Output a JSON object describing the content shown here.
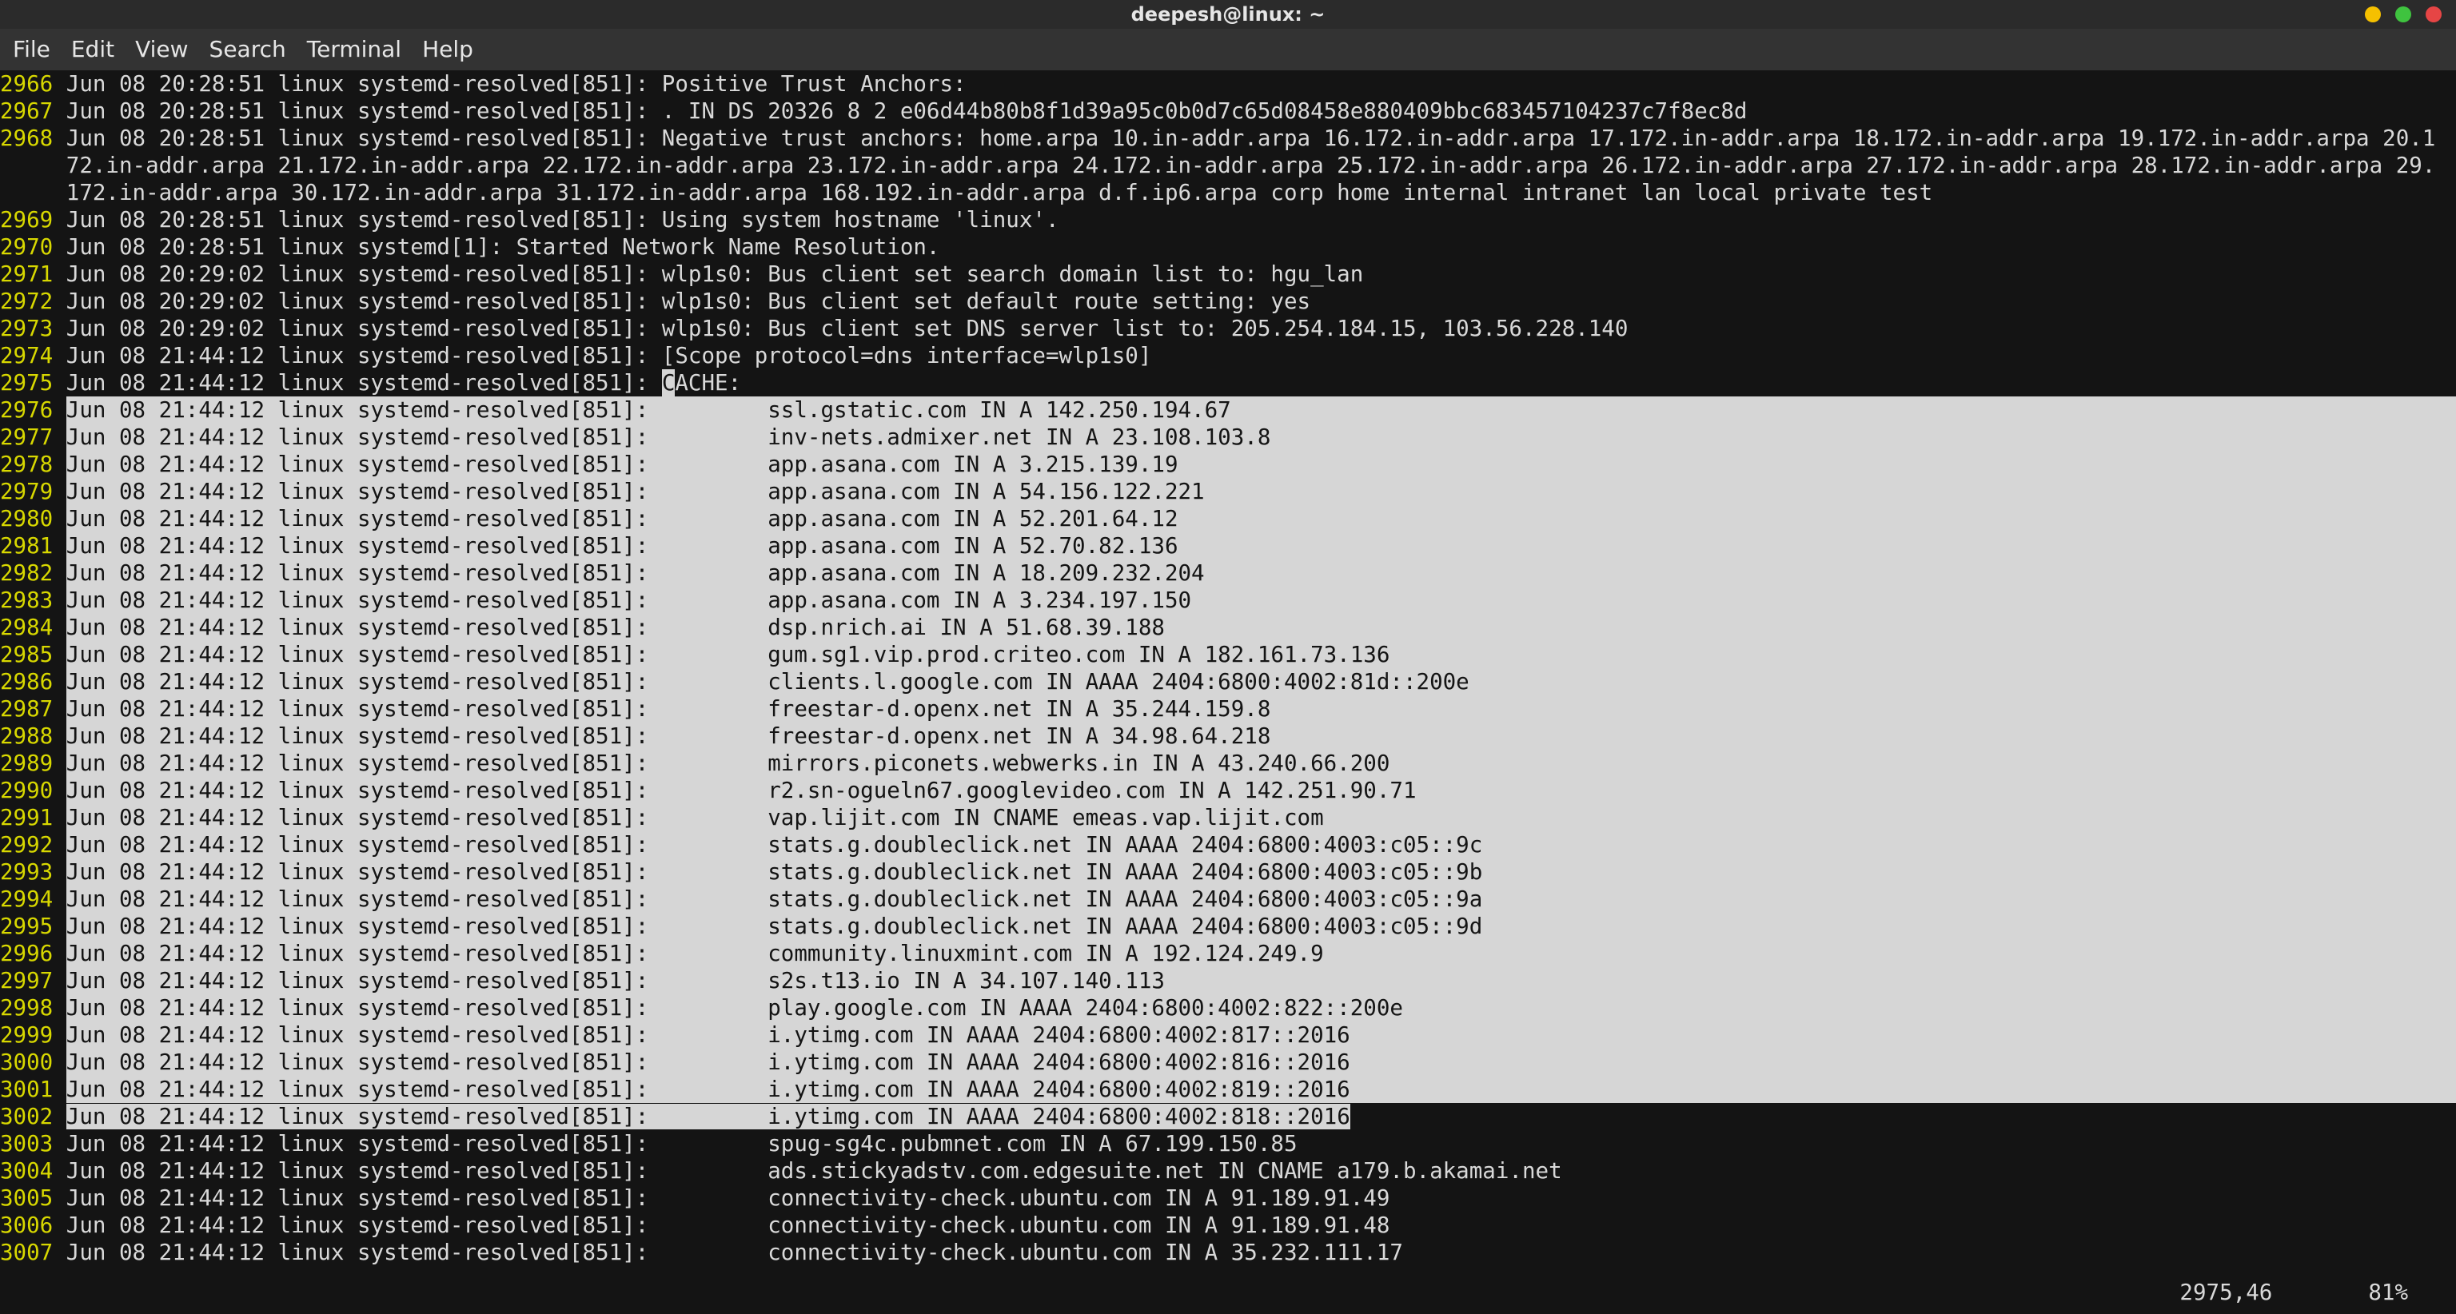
{
  "window": {
    "title": "deepesh@linux: ~"
  },
  "menubar": {
    "items": [
      "File",
      "Edit",
      "View",
      "Search",
      "Terminal",
      "Help"
    ]
  },
  "log_prefix_common": "Jun 08 21:44:12 linux systemd-resolved[851]:",
  "lines": [
    {
      "n": "2966",
      "text": "Jun 08 20:28:51 linux systemd-resolved[851]: Positive Trust Anchors:"
    },
    {
      "n": "2967",
      "text": "Jun 08 20:28:51 linux systemd-resolved[851]: . IN DS 20326 8 2 e06d44b80b8f1d39a95c0b0d7c65d08458e880409bbc683457104237c7f8ec8d"
    },
    {
      "n": "2968",
      "text": "Jun 08 20:28:51 linux systemd-resolved[851]: Negative trust anchors: home.arpa 10.in-addr.arpa 16.172.in-addr.arpa 17.172.in-addr.arpa 18.172.in-addr.arpa 19.172.in-addr.arpa 20.172.in-addr.arpa 21.172.in-addr.arpa 22.172.in-addr.arpa 23.172.in-addr.arpa 24.172.in-addr.arpa 25.172.in-addr.arpa 26.172.in-addr.arpa 27.172.in-addr.arpa 28.172.in-addr.arpa 29.172.in-addr.arpa 30.172.in-addr.arpa 31.172.in-addr.arpa 168.192.in-addr.arpa d.f.ip6.arpa corp home internal intranet lan local private test"
    },
    {
      "n": "2969",
      "text": "Jun 08 20:28:51 linux systemd-resolved[851]: Using system hostname 'linux'."
    },
    {
      "n": "2970",
      "text": "Jun 08 20:28:51 linux systemd[1]: Started Network Name Resolution."
    },
    {
      "n": "2971",
      "text": "Jun 08 20:29:02 linux systemd-resolved[851]: wlp1s0: Bus client set search domain list to: hgu_lan"
    },
    {
      "n": "2972",
      "text": "Jun 08 20:29:02 linux systemd-resolved[851]: wlp1s0: Bus client set default route setting: yes"
    },
    {
      "n": "2973",
      "text": "Jun 08 20:29:02 linux systemd-resolved[851]: wlp1s0: Bus client set DNS server list to: 205.254.184.15, 103.56.228.140"
    },
    {
      "n": "2974",
      "text": "Jun 08 21:44:12 linux systemd-resolved[851]: [Scope protocol=dns interface=wlp1s0]"
    }
  ],
  "cache_line": {
    "n": "2975",
    "prefix": "Jun 08 21:44:12 linux systemd-resolved[851]: ",
    "cursor_char": "C",
    "after": "ACHE:"
  },
  "selected_lines": [
    {
      "n": "2976",
      "val": "ssl.gstatic.com IN A 142.250.194.67"
    },
    {
      "n": "2977",
      "val": "inv-nets.admixer.net IN A 23.108.103.8"
    },
    {
      "n": "2978",
      "val": "app.asana.com IN A 3.215.139.19"
    },
    {
      "n": "2979",
      "val": "app.asana.com IN A 54.156.122.221"
    },
    {
      "n": "2980",
      "val": "app.asana.com IN A 52.201.64.12"
    },
    {
      "n": "2981",
      "val": "app.asana.com IN A 52.70.82.136"
    },
    {
      "n": "2982",
      "val": "app.asana.com IN A 18.209.232.204"
    },
    {
      "n": "2983",
      "val": "app.asana.com IN A 3.234.197.150"
    },
    {
      "n": "2984",
      "val": "dsp.nrich.ai IN A 51.68.39.188"
    },
    {
      "n": "2985",
      "val": "gum.sg1.vip.prod.criteo.com IN A 182.161.73.136"
    },
    {
      "n": "2986",
      "val": "clients.l.google.com IN AAAA 2404:6800:4002:81d::200e"
    },
    {
      "n": "2987",
      "val": "freestar-d.openx.net IN A 35.244.159.8"
    },
    {
      "n": "2988",
      "val": "freestar-d.openx.net IN A 34.98.64.218"
    },
    {
      "n": "2989",
      "val": "mirrors.piconets.webwerks.in IN A 43.240.66.200"
    },
    {
      "n": "2990",
      "val": "r2.sn-ogueln67.googlevideo.com IN A 142.251.90.71"
    },
    {
      "n": "2991",
      "val": "vap.lijit.com IN CNAME emeas.vap.lijit.com"
    },
    {
      "n": "2992",
      "val": "stats.g.doubleclick.net IN AAAA 2404:6800:4003:c05::9c"
    },
    {
      "n": "2993",
      "val": "stats.g.doubleclick.net IN AAAA 2404:6800:4003:c05::9b"
    },
    {
      "n": "2994",
      "val": "stats.g.doubleclick.net IN AAAA 2404:6800:4003:c05::9a"
    },
    {
      "n": "2995",
      "val": "stats.g.doubleclick.net IN AAAA 2404:6800:4003:c05::9d"
    },
    {
      "n": "2996",
      "val": "community.linuxmint.com IN A 192.124.249.9"
    },
    {
      "n": "2997",
      "val": "s2s.t13.io IN A 34.107.140.113"
    },
    {
      "n": "2998",
      "val": "play.google.com IN AAAA 2404:6800:4002:822::200e"
    },
    {
      "n": "2999",
      "val": "i.ytimg.com IN AAAA 2404:6800:4002:817::2016"
    },
    {
      "n": "3000",
      "val": "i.ytimg.com IN AAAA 2404:6800:4002:816::2016"
    },
    {
      "n": "3001",
      "val": "i.ytimg.com IN AAAA 2404:6800:4002:819::2016"
    },
    {
      "n": "3002",
      "val": "i.ytimg.com IN AAAA 2404:6800:4002:818::2016",
      "last": true
    }
  ],
  "post_lines": [
    {
      "n": "3003",
      "val": "spug-sg4c.pubmnet.com IN A 67.199.150.85"
    },
    {
      "n": "3004",
      "val": "ads.stickyadstv.com.edgesuite.net IN CNAME a179.b.akamai.net"
    },
    {
      "n": "3005",
      "val": "connectivity-check.ubuntu.com IN A 91.189.91.49"
    },
    {
      "n": "3006",
      "val": "connectivity-check.ubuntu.com IN A 91.189.91.48"
    },
    {
      "n": "3007",
      "val": "connectivity-check.ubuntu.com IN A 35.232.111.17"
    }
  ],
  "status": {
    "pos": "2975,46",
    "pct": "81%"
  }
}
